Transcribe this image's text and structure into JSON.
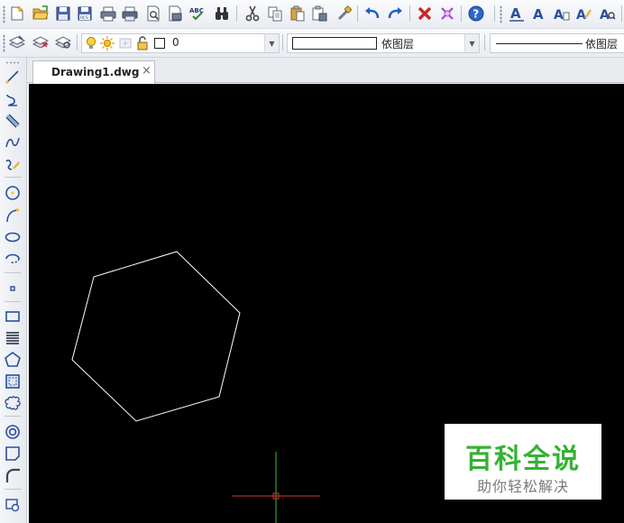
{
  "layer_toolbar": {
    "layer_name": "0",
    "color_value": "依图层",
    "linetype_value": "依图层"
  },
  "tabs": [
    {
      "label": "Drawing1.dwg",
      "close": "×"
    }
  ],
  "canvas": {
    "background": "#000000",
    "entity_color": "#ffffff",
    "crosshair_x_color": "#e03030",
    "crosshair_y_color": "#2fc02f"
  },
  "watermark": {
    "title": "百科全说",
    "subtitle": "助你轻松解决",
    "title_color": "#35b233"
  },
  "icons": {
    "toolbar_row1": [
      "new-file-icon",
      "open-folder-icon",
      "save-icon",
      "saveas-icon",
      "print-icon",
      "plot-icon",
      "print-preview-icon",
      "publish-icon",
      "spellcheck-icon",
      "find-icon",
      "cut-icon",
      "copy-icon",
      "paste-icon",
      "paste-special-icon",
      "match-properties-icon",
      "undo-icon",
      "redo-icon",
      "delete-icon",
      "erase-x-icon",
      "help-icon",
      "text-style-icon",
      "text-icon",
      "text-edit-icon",
      "text-find-icon",
      "text-scale-icon"
    ],
    "toolbar_row2": [
      "layer-manager-icon",
      "layer-state-icon",
      "layer-previous-icon",
      "bulb-icon",
      "sun-icon",
      "freeze-icon",
      "lock-icon",
      "color-square-icon"
    ],
    "draw_tools": [
      "line-icon",
      "polyline-icon",
      "multiline-icon",
      "spline-icon",
      "freehand-icon",
      "circle-icon",
      "arc-icon",
      "ellipse-icon",
      "ellipse-arc-icon",
      "point-icon",
      "rectangle-icon",
      "hatch-stack-icon",
      "polygon-icon",
      "region-icon",
      "revision-cloud-icon",
      "donut-icon",
      "wipeout-icon",
      "fillet-icon",
      "block-insert-icon"
    ]
  }
}
